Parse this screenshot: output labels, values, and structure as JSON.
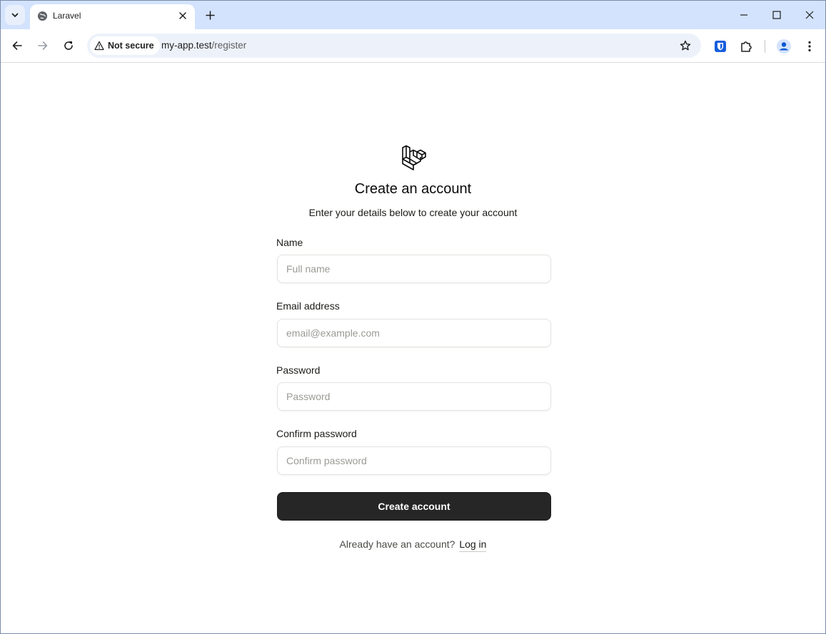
{
  "browser": {
    "tab_title": "Laravel",
    "security_label": "Not secure",
    "url_host": "my-app.test",
    "url_path": "/register",
    "icons": {
      "tab_search": "chevron-down-icon",
      "favicon": "globe-icon",
      "tab_close": "close-icon",
      "new_tab": "plus-icon",
      "minimize": "minimize-icon",
      "maximize": "maximize-icon",
      "close_window": "close-icon",
      "back": "arrow-left-icon",
      "forward": "arrow-right-icon",
      "reload": "reload-icon",
      "warning": "warning-icon",
      "bookmark": "star-icon",
      "bitwarden": "shield-icon",
      "extensions": "puzzle-icon",
      "profile": "person-icon",
      "menu": "kebab-menu-icon"
    }
  },
  "page": {
    "logo": "laravel-logo",
    "title": "Create an account",
    "subtitle": "Enter your details below to create your account",
    "fields": [
      {
        "label": "Name",
        "placeholder": "Full name",
        "value": ""
      },
      {
        "label": "Email address",
        "placeholder": "email@example.com",
        "value": ""
      },
      {
        "label": "Password",
        "placeholder": "Password",
        "value": ""
      },
      {
        "label": "Confirm password",
        "placeholder": "Confirm password",
        "value": ""
      }
    ],
    "submit_label": "Create account",
    "login_prompt": "Already have an account?",
    "login_link": "Log in"
  },
  "colors": {
    "tabstrip": "#d3e3fd",
    "omnibox": "#edf2fa",
    "button_bg": "#262626",
    "button_text": "#ffffff",
    "input_border": "#e3e3e0"
  }
}
